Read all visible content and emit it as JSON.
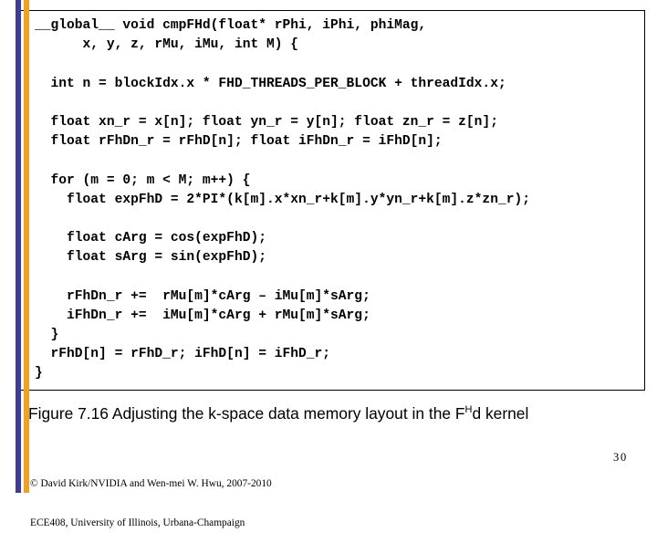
{
  "slide": {
    "code_box": {
      "language": "cuda-c",
      "lines": [
        "__global__ void cmpFHd(float* rPhi, iPhi, phiMag,",
        "      x, y, z, rMu, iMu, int M) {",
        "",
        "  int n = blockIdx.x * FHD_THREADS_PER_BLOCK + threadIdx.x;",
        "",
        "  float xn_r = x[n]; float yn_r = y[n]; float zn_r = z[n];",
        "  float rFhDn_r = rFhD[n]; float iFhDn_r = iFhD[n];",
        "",
        "  for (m = 0; m < M; m++) {",
        "    float expFhD = 2*PI*(k[m].x*xn_r+k[m].y*yn_r+k[m].z*zn_r);",
        "",
        "    float cArg = cos(expFhD);",
        "    float sArg = sin(expFhD);",
        "",
        "    rFhDn_r +=  rMu[m]*cArg – iMu[m]*sArg;",
        "    iFhDn_r +=  iMu[m]*cArg + rMu[m]*sArg;",
        "  }",
        "  rFhD[n] = rFhD_r; iFhD[n] = iFhD_r;",
        "}"
      ]
    },
    "caption": {
      "prefix": "Figure 7.16 Adjusting the k-space data memory layout in the F",
      "superscript": "H",
      "suffix": "d kernel"
    },
    "footer": {
      "line1": "© David Kirk/NVIDIA and Wen-mei W. Hwu, 2007-2010",
      "line2": "ECE408, University of Illinois, Urbana-Champaign"
    },
    "page_number": {
      "digit_1": "3",
      "digit_2": "0"
    },
    "accent_colors": {
      "bar_blue": "#3b3ba0",
      "bar_orange": "#f0a21e",
      "box_border": "#000000",
      "text": "#000000",
      "background": "#ffffff"
    }
  }
}
